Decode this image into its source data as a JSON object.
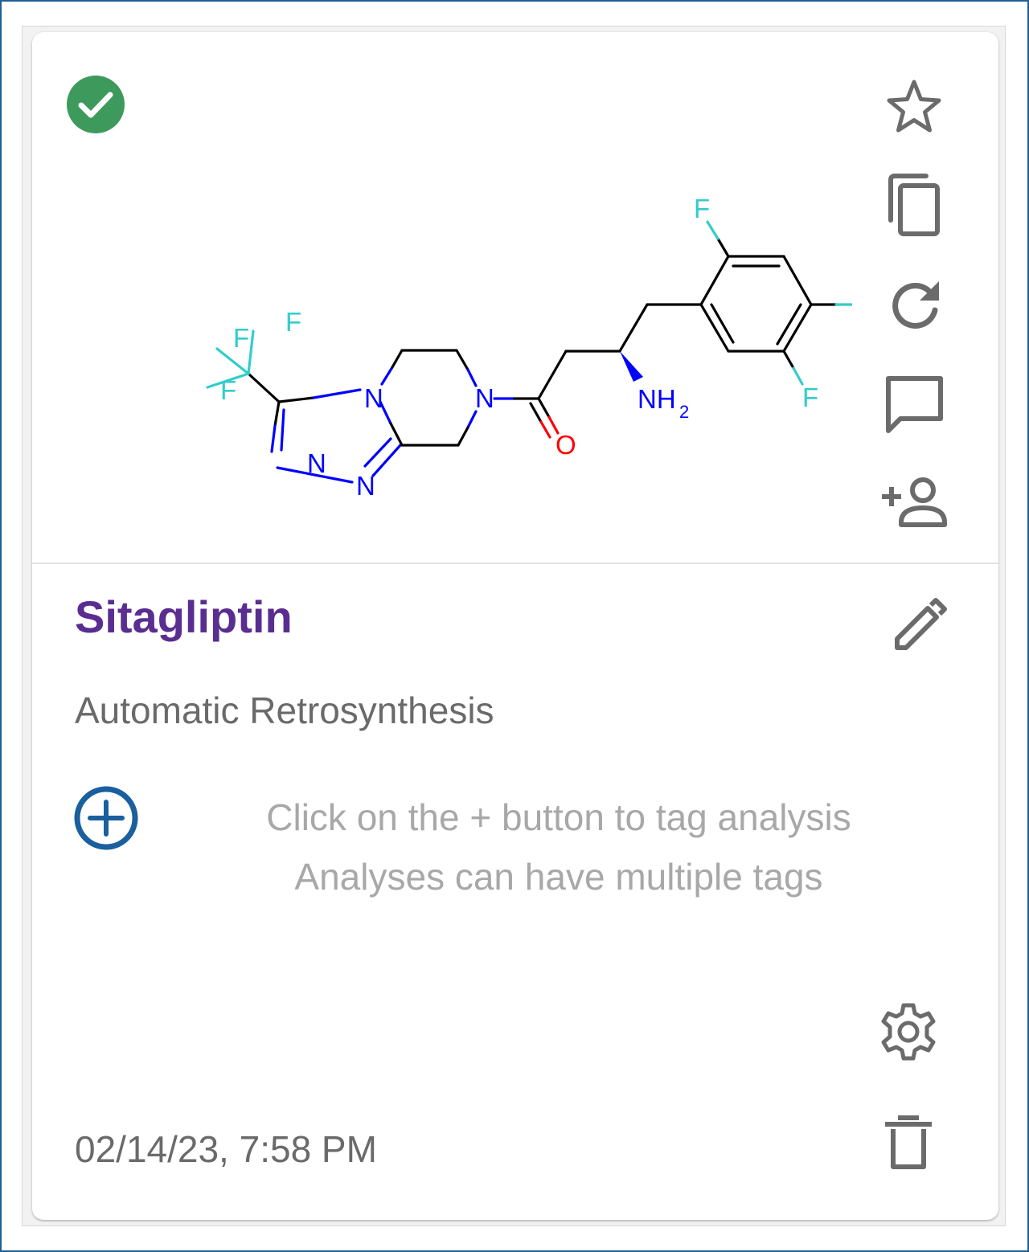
{
  "card": {
    "status": "completed",
    "status_color": "#3d9a5c",
    "title": "Sitagliptin",
    "title_color": "#5a2d91",
    "subtitle": "Automatic Retrosynthesis",
    "tags_hint": {
      "line1": "Click on the + button to tag analysis",
      "line2": "Analyses can have multiple tags"
    },
    "timestamp": "02/14/23, 7:58 PM",
    "accent_color": "#1a5f9e"
  },
  "actions": [
    {
      "icon": "star-icon",
      "label": "favorite"
    },
    {
      "icon": "copy-icon",
      "label": "duplicate"
    },
    {
      "icon": "refresh-icon",
      "label": "rerun"
    },
    {
      "icon": "comment-icon",
      "label": "comments"
    },
    {
      "icon": "person-add-icon",
      "label": "share"
    },
    {
      "icon": "pencil-icon",
      "label": "edit"
    },
    {
      "icon": "gear-icon",
      "label": "settings"
    },
    {
      "icon": "trash-icon",
      "label": "delete"
    }
  ],
  "structure": {
    "atom_labels": {
      "f1": "F",
      "f2": "F",
      "f3": "F",
      "n1": "N",
      "n2": "N",
      "n3": "N",
      "n4": "N",
      "o": "O",
      "nh": "NH",
      "nh_sub": "2",
      "fa": "F",
      "fb": "F",
      "fc": "F"
    },
    "colors": {
      "bond": "#000000",
      "nitrogen": "#0000ff",
      "oxygen": "#ff0000",
      "fluorine": "#33cccc"
    }
  }
}
